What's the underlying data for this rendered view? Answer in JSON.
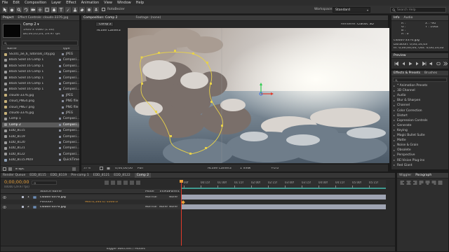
{
  "menu": [
    "File",
    "Edit",
    "Composition",
    "Layer",
    "Effect",
    "Animation",
    "View",
    "Window",
    "Help"
  ],
  "toolbar": {
    "workspace_label": "Workspace:",
    "workspace_value": "Standard",
    "search_placeholder": "Search Help",
    "rotobezier": "RotoBezier"
  },
  "project": {
    "tabs": [
      "Project",
      "Effect Controls: clouds-3376.jpg"
    ],
    "comp_name": "Comp 2 ▾",
    "comp_info": [
      "1920 x 1080 (1.00)",
      "Δ0;00;05;24, 29.97 fps"
    ],
    "search_placeholder": "",
    "col_name": "Name",
    "col_type": "Type",
    "items": [
      {
        "name": "SS101_ae_6_Tutorials_city.jpg",
        "type": "JPEG",
        "color": "#c8b27a"
      },
      {
        "name": "Black Solid 16 Comp 1",
        "type": "Composi...",
        "color": "#9a9a9a"
      },
      {
        "name": "Black Solid 16 Comp 1",
        "type": "Composi...",
        "color": "#9a9a9a"
      },
      {
        "name": "Black Solid 16 Comp 1",
        "type": "Composi...",
        "color": "#9a9a9a"
      },
      {
        "name": "Black Solid 16 Comp 1",
        "type": "Composi...",
        "color": "#9a9a9a"
      },
      {
        "name": "Black Solid 16 Comp 1",
        "type": "Composi...",
        "color": "#9a9a9a"
      },
      {
        "name": "Black Solid 16 Comp 1",
        "type": "Composi...",
        "color": "#9a9a9a"
      },
      {
        "name": "clouds-3376.jpg",
        "type": "JPEG",
        "color": "#c8b27a"
      },
      {
        "name": "cloud_PNG4.png",
        "type": "PNG file",
        "color": "#c8b27a"
      },
      {
        "name": "cloud_PNG7.png",
        "type": "PNG file",
        "color": "#c8b27a"
      },
      {
        "name": "clouds-3376.jpg",
        "type": "JPEG",
        "color": "#c8b27a"
      },
      {
        "name": "Comp 1",
        "type": "Composi...",
        "color": "#9a9a9a"
      },
      {
        "name": "Comp 2",
        "type": "Composi...",
        "color": "#9a9a9a",
        "selected": true
      },
      {
        "name": "EDD_8115",
        "type": "Composi...",
        "color": "#9a9a9a"
      },
      {
        "name": "EDD_8119",
        "type": "Composi...",
        "color": "#9a9a9a"
      },
      {
        "name": "EDD_8120",
        "type": "Composi...",
        "color": "#9a9a9a"
      },
      {
        "name": "EDD_8121",
        "type": "Composi...",
        "color": "#9a9a9a"
      },
      {
        "name": "EDD_8122",
        "type": "Composi...",
        "color": "#9a9a9a"
      },
      {
        "name": "EDD_8115.MOV",
        "type": "QuickTime",
        "color": "#8ea0b8"
      }
    ],
    "bpc": "8 bpc"
  },
  "composition": {
    "tabs": [
      "Composition: Comp 2",
      "Footage: (none)"
    ],
    "subtab": "Comp 2",
    "renderer_label": "Renderer:",
    "renderer_value": "Classic 3D",
    "camera_label": "Active Camera",
    "zoom": "37%",
    "timecode": "0;00;00;00",
    "resolution": "Full",
    "view_camera": "Active Camera",
    "views": "1 View",
    "offset": "+0.0"
  },
  "info": {
    "tabs": [
      "Info",
      "Audio"
    ],
    "lines": [
      "R :",
      "G :",
      "B :",
      "A : 0"
    ],
    "coords": [
      "X : -90",
      "Y : 1062"
    ],
    "layer_name": "clouds-3376.jpg",
    "layer_times": [
      "Duration: 0;00;14;03",
      "In: 0;00;00;00, Out: 0;00;14;02"
    ]
  },
  "preview": {
    "tab": "Preview"
  },
  "effects": {
    "tabs": [
      "Effects & Presets",
      "Brushes"
    ],
    "search_placeholder": "",
    "items": [
      "* Animation Presets",
      "3D Channel",
      "Audio",
      "Blur & Sharpen",
      "Channel",
      "Color Correction",
      "Distort",
      "Expression Controls",
      "Generate",
      "Keying",
      "Magic Bullet Suite",
      "Matte",
      "Noise & Grain",
      "Obsolete",
      "Perspective",
      "RE:Vision Plug-ins",
      "Red Giant"
    ]
  },
  "paragraph": {
    "tabs": [
      "Wiggler",
      "Paragraph"
    ]
  },
  "timeline": {
    "tabs": [
      "Render Queue",
      "EDD_8115",
      "EDD_8119",
      "Pre-comp 1",
      "EDD_8121",
      "EDD_8122",
      "Comp 2"
    ],
    "current_time": "0;00;00;00",
    "frames": "00000 (29.97 fps)",
    "col_source": "Source Name",
    "col_mode": "Mode",
    "col_trkmat": "TrkMat",
    "col_parent": "Parent",
    "layers": [
      {
        "num": "1",
        "name": "clouds-3376.jpg",
        "mode": "Normal",
        "parent": "None"
      },
      {
        "num": "2",
        "name": "clouds-3376.jpg",
        "mode": "Normal",
        "trkmat": "None",
        "parent": "None"
      }
    ],
    "prop_name": "Position",
    "prop_value": "960.0,540.0,-1000.0",
    "ruler": [
      "00f",
      "00:15f",
      "01:00f",
      "01:15f",
      "02:00f",
      "02:15f",
      "03:00f",
      "03:15f",
      "04:00f",
      "04:15f",
      "05:00f",
      "05:15f"
    ],
    "toggle_label": "Toggle Switches / Modes"
  },
  "colors": {
    "accent": "#e8a03a",
    "track_teal": "#3f9a8f",
    "track_label": "#b1b6c6"
  }
}
